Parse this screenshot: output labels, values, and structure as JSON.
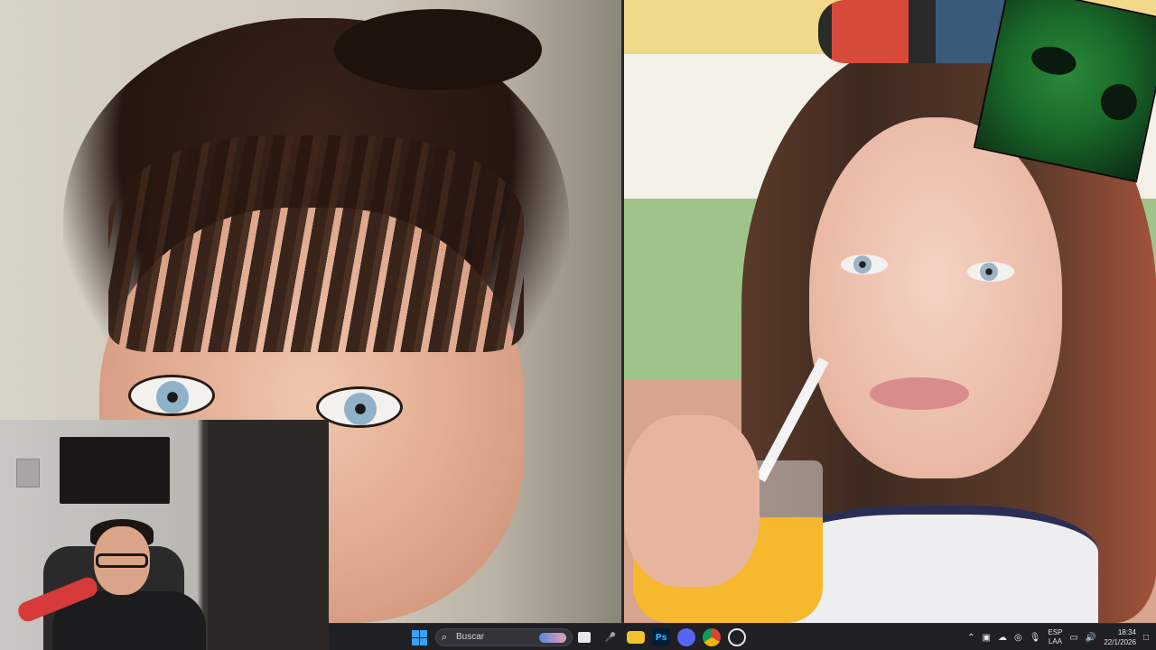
{
  "taskbar": {
    "search_placeholder": "Buscar",
    "apps": [
      {
        "name": "start",
        "icon": "windows-start-icon"
      },
      {
        "name": "task-view",
        "icon": "task-view-icon"
      },
      {
        "name": "microphone",
        "icon": "microphone-app-icon"
      },
      {
        "name": "file-explorer",
        "icon": "folder-icon",
        "color": "#f2c230"
      },
      {
        "name": "photoshop",
        "icon": "photoshop-icon",
        "label": "Ps",
        "color": "#31a8ff"
      },
      {
        "name": "discord",
        "icon": "discord-icon",
        "color": "#5865f2"
      },
      {
        "name": "chrome",
        "icon": "chrome-icon"
      },
      {
        "name": "other-app",
        "icon": "app-icon"
      }
    ],
    "tray": {
      "language_top": "ESP",
      "language_bottom": "LAA",
      "time": "18:34",
      "date": "22/1/2026"
    }
  },
  "colors": {
    "taskbar_bg": "#1f1f24",
    "accent": "#3aa0f0"
  }
}
